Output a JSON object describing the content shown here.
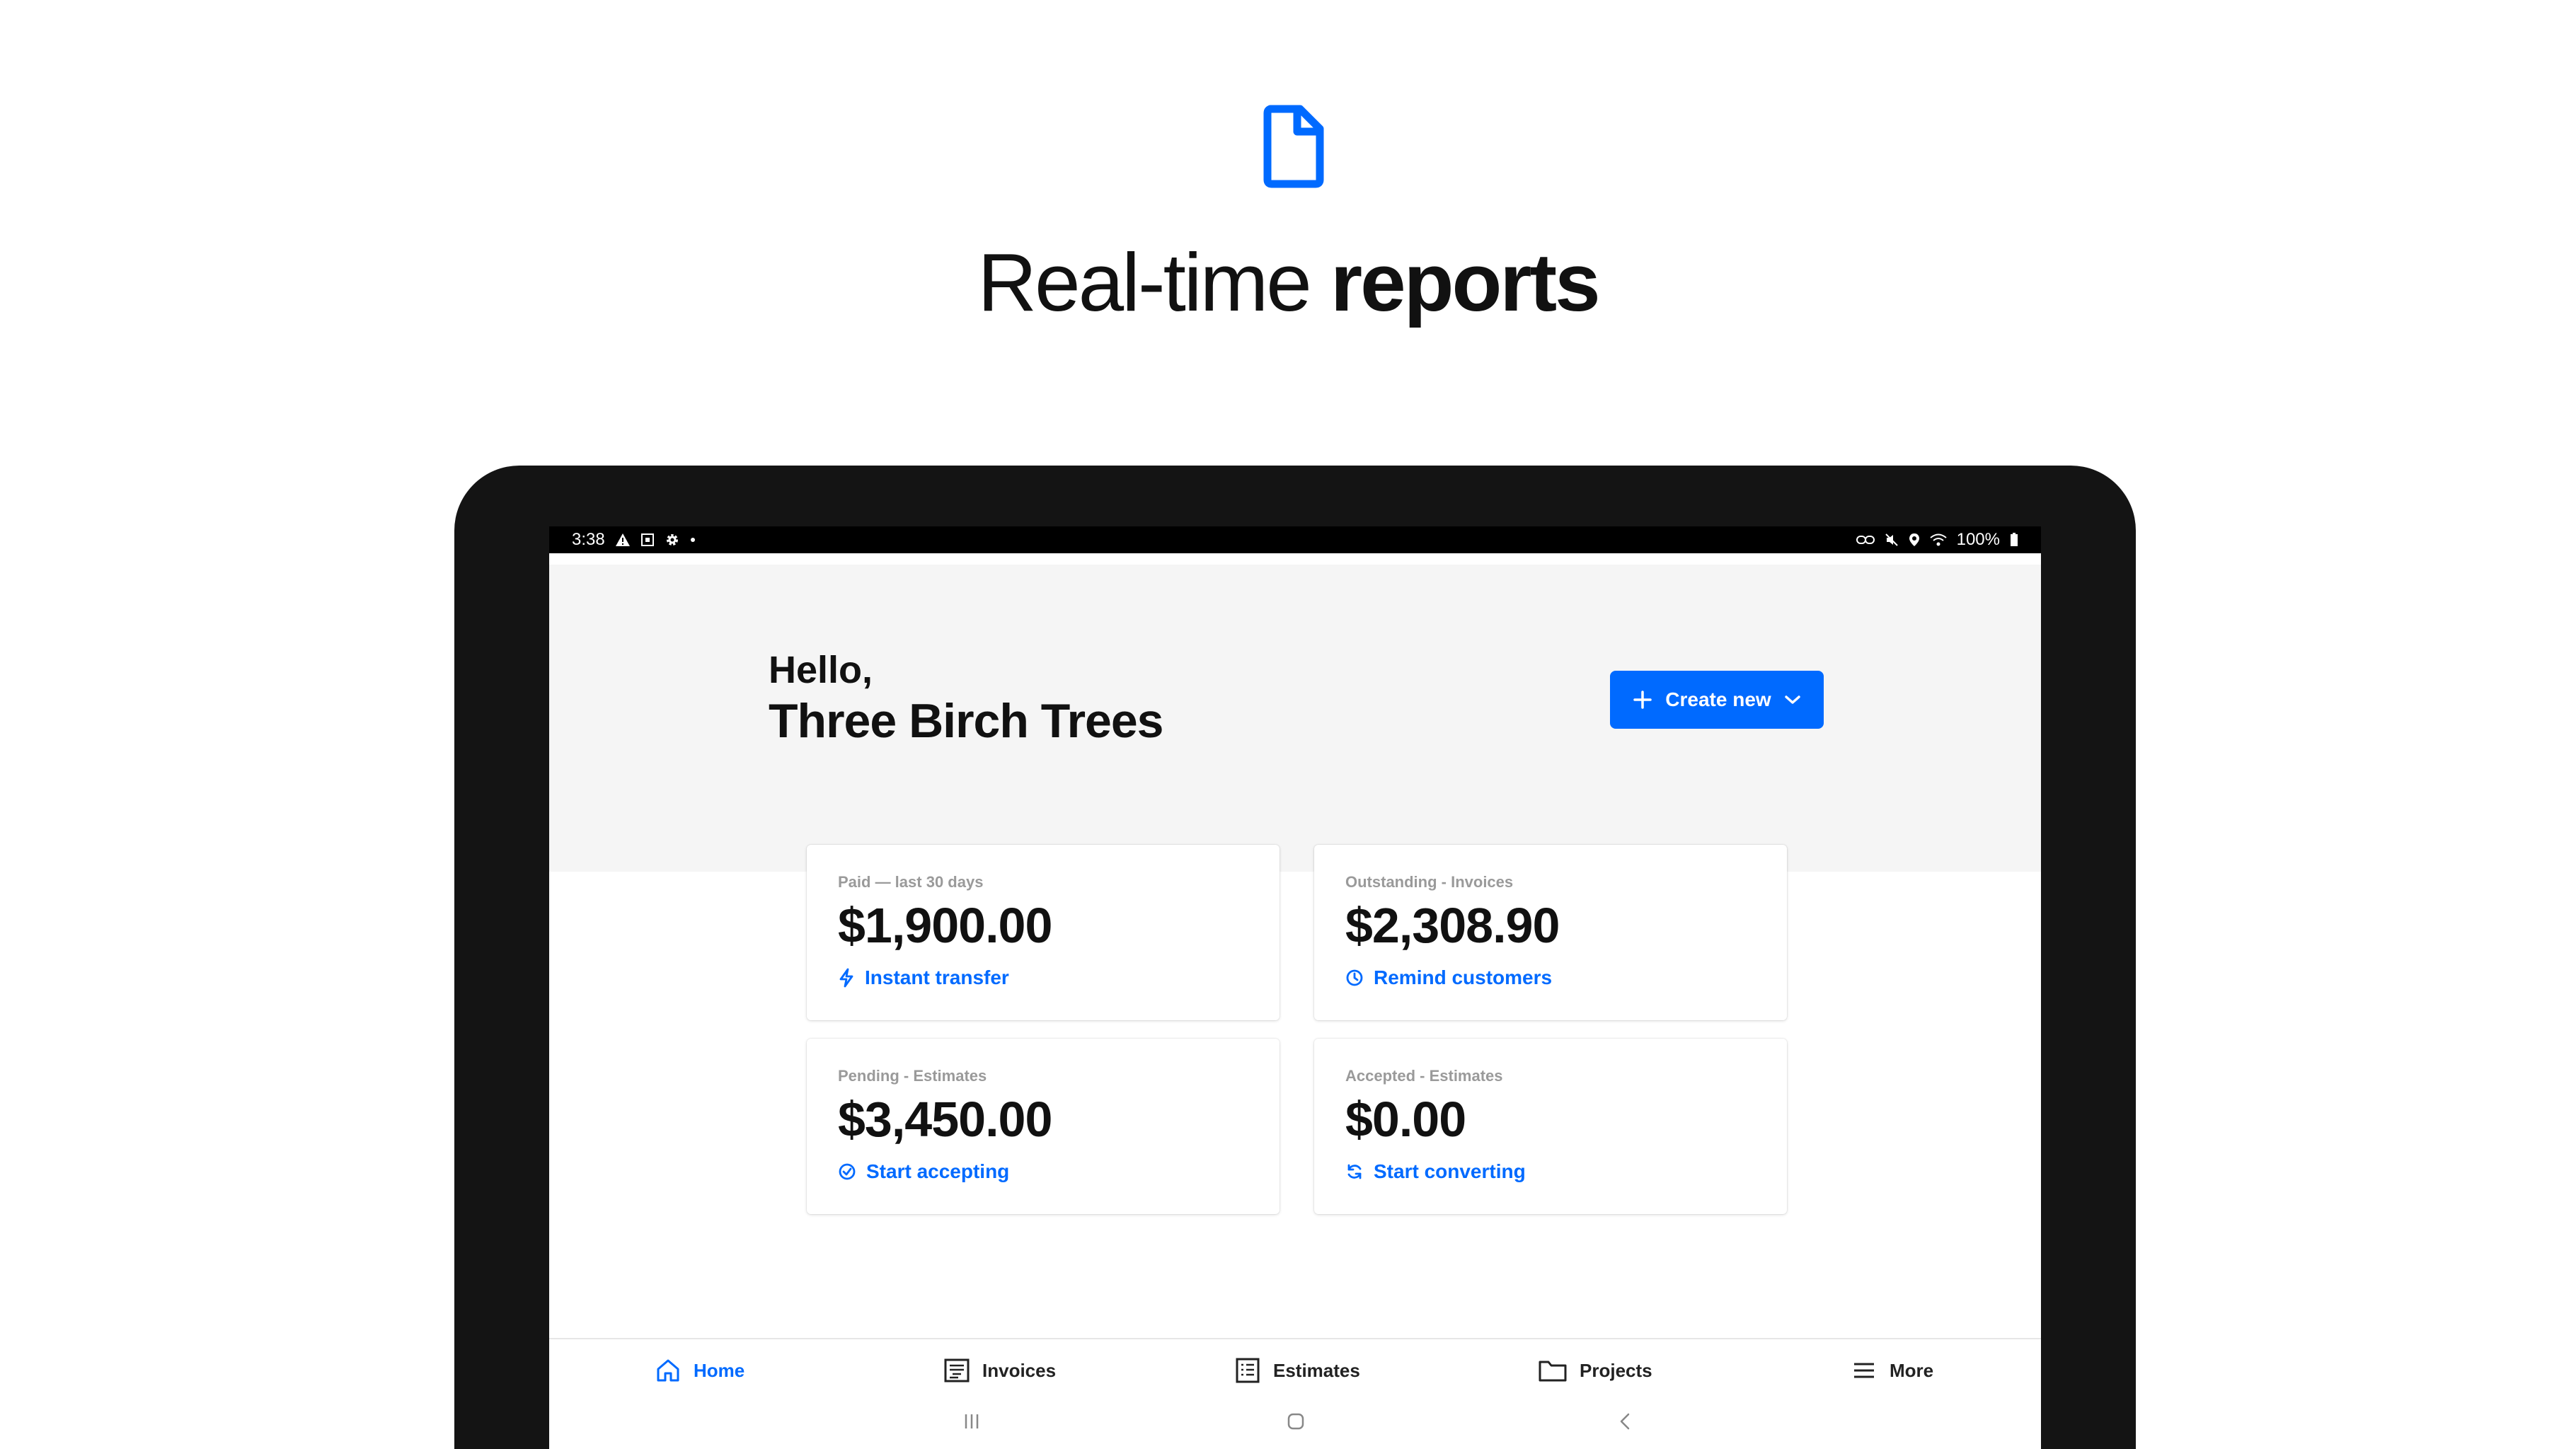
{
  "promo": {
    "title_light": "Real-time ",
    "title_bold": "reports",
    "icon": "document-icon",
    "accent_color": "#006aff"
  },
  "statusbar": {
    "time": "3:38",
    "battery": "100%"
  },
  "greeting": {
    "hello": "Hello,",
    "business_name": "Three Birch Trees"
  },
  "create_button": {
    "label": "Create new"
  },
  "cards": [
    {
      "label": "Paid — last 30 days",
      "amount": "$1,900.00",
      "action": "Instant transfer",
      "icon": "lightning-icon"
    },
    {
      "label": "Outstanding - Invoices",
      "amount": "$2,308.90",
      "action": "Remind customers",
      "icon": "clock-icon"
    },
    {
      "label": "Pending - Estimates",
      "amount": "$3,450.00",
      "action": "Start accepting",
      "icon": "check-circle-icon"
    },
    {
      "label": "Accepted - Estimates",
      "amount": "$0.00",
      "action": "Start converting",
      "icon": "refresh-icon"
    }
  ],
  "nav": {
    "items": [
      {
        "label": "Home",
        "icon": "home-icon",
        "active": true
      },
      {
        "label": "Invoices",
        "icon": "invoice-icon",
        "active": false
      },
      {
        "label": "Estimates",
        "icon": "estimate-icon",
        "active": false
      },
      {
        "label": "Projects",
        "icon": "folder-icon",
        "active": false
      },
      {
        "label": "More",
        "icon": "menu-icon",
        "active": false
      }
    ]
  }
}
